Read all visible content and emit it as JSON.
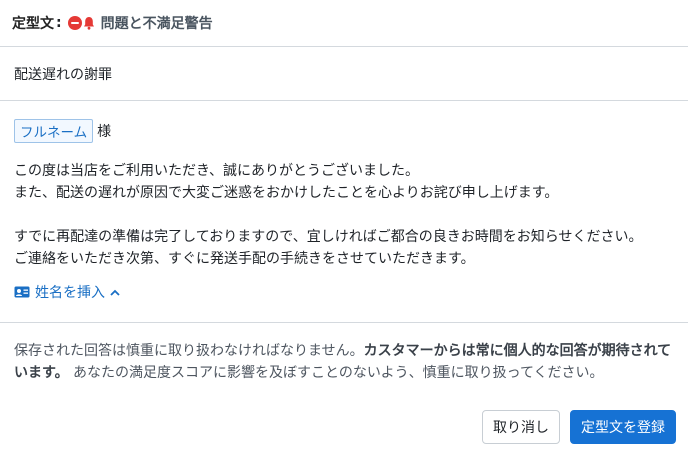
{
  "header": {
    "label": "定型文",
    "separator": ":",
    "title": "問題と不満足警告",
    "icons": [
      "minus-circle-icon",
      "bell-icon"
    ]
  },
  "subject": "配送遅れの謝罪",
  "body": {
    "variable_tag": "フルネーム",
    "honorific": "様",
    "paragraph1_line1": "この度は当店をご利用いただき、誠にありがとうございました。",
    "paragraph1_line2": "また、配送の遅れが原因で大変ご迷惑をおかけしたことを心よりお詫び申し上げます。",
    "paragraph2_line1": "すでに再配達の準備は完了しておりますので、宜しければご都合の良きお時間をお知らせください。",
    "paragraph2_line2": "ご連絡をいただき次第、すぐに発送手配の手続きをさせていただきます。",
    "insert_name_label": "姓名を挿入"
  },
  "notice": {
    "text_before": "保存された回答は慎重に取り扱わなければなりません。",
    "text_bold": "カスタマーからは常に個人的な回答が期待されています。",
    "text_after": " あなたの満足度スコアに影響を及ぼすことのないよう、慎重に取り扱ってください。"
  },
  "footer": {
    "cancel_label": "取り消し",
    "save_label": "定型文を登録"
  },
  "colors": {
    "accent": "#1672d4",
    "alert_red": "#e53935",
    "link": "#1a6fc4"
  }
}
